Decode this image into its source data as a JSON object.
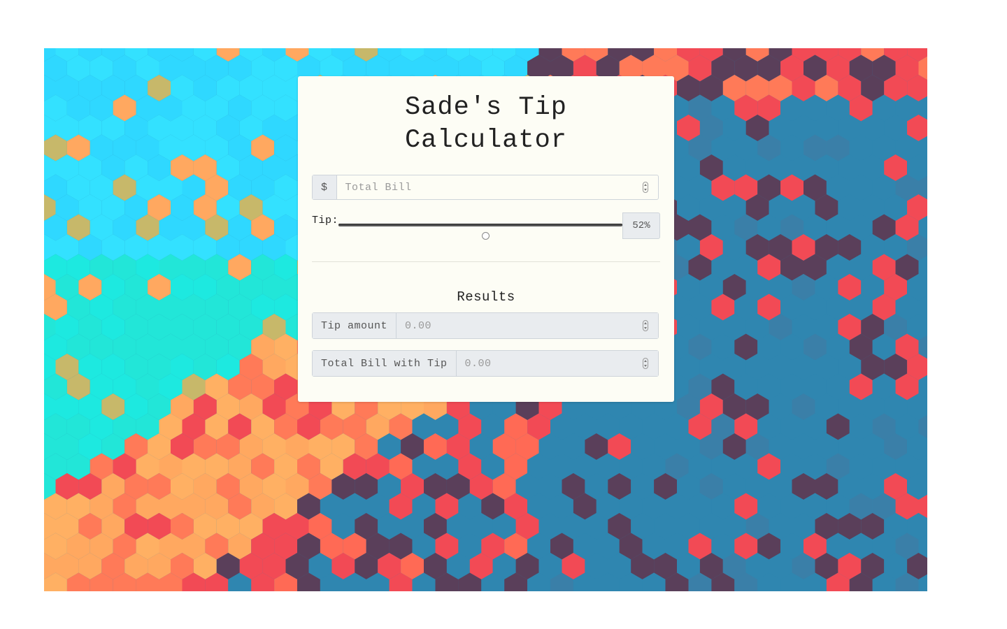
{
  "app": {
    "title_line1": "Sade's Tip",
    "title_line2": "Calculator"
  },
  "bill": {
    "currency_symbol": "$",
    "placeholder": "Total Bill",
    "value": ""
  },
  "tip": {
    "label": "Tip:",
    "percent_value": 52,
    "percent_display": "52%"
  },
  "results": {
    "heading": "Results",
    "tip_amount_label": "Tip amount",
    "tip_amount_value": "0.00",
    "total_label": "Total Bill with Tip",
    "total_value": "0.00"
  },
  "background": {
    "description_colors": [
      "#33e1ff",
      "#1de9e0",
      "#ffa860",
      "#f24a55",
      "#5a3f5a",
      "#2f86b0"
    ]
  }
}
